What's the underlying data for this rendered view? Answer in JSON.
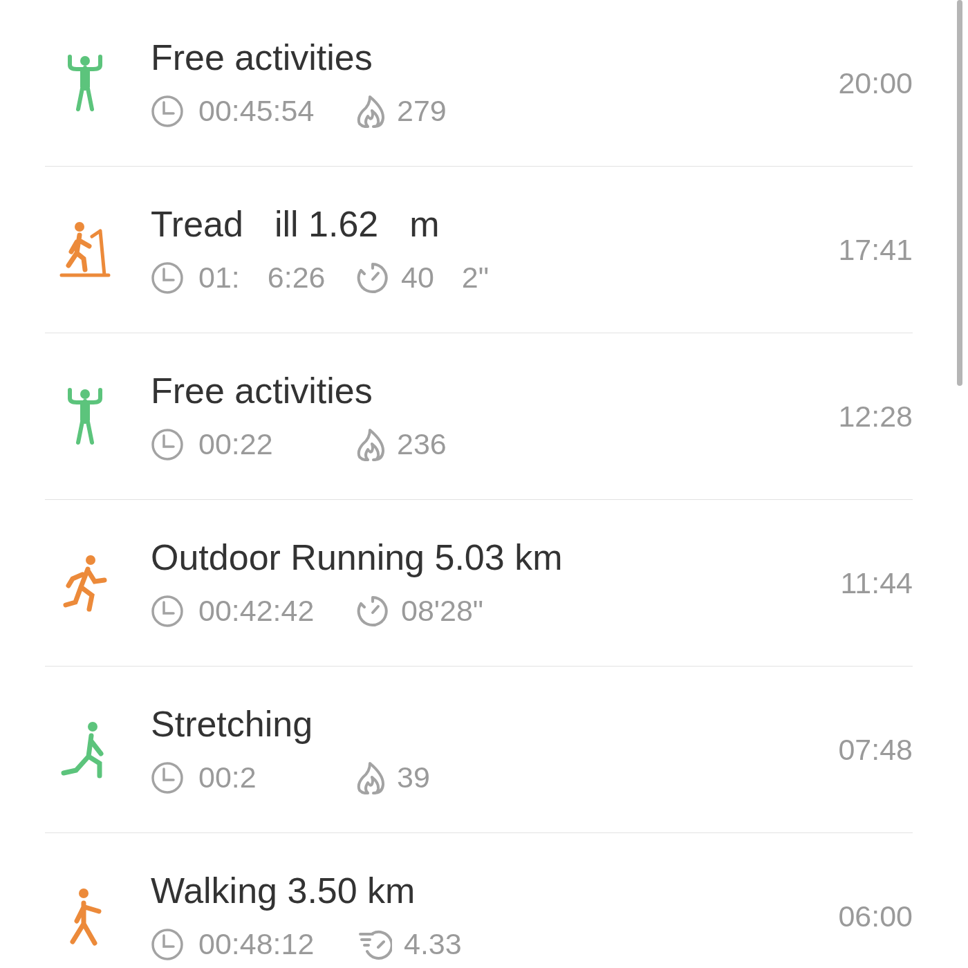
{
  "activities": [
    {
      "kind": "standing",
      "color": "#5cc47c",
      "title": [
        "Free activities"
      ],
      "duration": [
        "00:45:54"
      ],
      "metric": {
        "kind": "flame",
        "text": [
          "279"
        ]
      },
      "time": "20:00"
    },
    {
      "kind": "treadmill",
      "color": "#ec8a3a",
      "title": [
        "Tread",
        "ill 1.62",
        "m"
      ],
      "duration": [
        "01:",
        "6:26"
      ],
      "metric": {
        "kind": "gauge",
        "text": [
          "40",
          "2\""
        ]
      },
      "time": "17:41"
    },
    {
      "kind": "standing",
      "color": "#5cc47c",
      "title": [
        "Free activities"
      ],
      "duration": [
        "00:22"
      ],
      "metric": {
        "kind": "flame",
        "text": [
          "236"
        ]
      },
      "time": "12:28"
    },
    {
      "kind": "running",
      "color": "#ec8a3a",
      "title": [
        "Outdoor Running 5.03 km"
      ],
      "duration": [
        "00:42:42"
      ],
      "metric": {
        "kind": "gauge",
        "text": [
          "08'28\""
        ]
      },
      "time": "11:44"
    },
    {
      "kind": "stretching",
      "color": "#5cc47c",
      "title": [
        "Stretching"
      ],
      "duration": [
        "00:2"
      ],
      "metric": {
        "kind": "flame",
        "text": [
          "39"
        ]
      },
      "time": "07:48"
    },
    {
      "kind": "walking",
      "color": "#ec8a3a",
      "title": [
        "Walking 3.50 km"
      ],
      "duration": [
        "00:48:12"
      ],
      "metric": {
        "kind": "cadence",
        "text": [
          "4.33"
        ]
      },
      "time": "06:00"
    }
  ]
}
